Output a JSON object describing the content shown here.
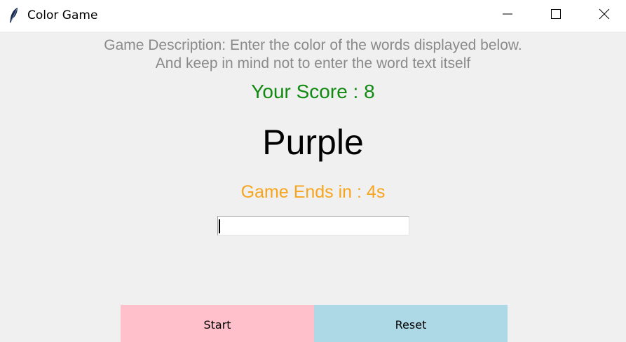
{
  "window": {
    "title": "Color Game"
  },
  "game": {
    "description_line1": "Game Description: Enter the color of the words displayed below.",
    "description_line2": "And keep in mind not to enter the word text itself",
    "score": "Your Score : 8",
    "word": "Purple",
    "timer": "Game Ends in : 4s",
    "input_value": ""
  },
  "buttons": {
    "start_label": "Start",
    "reset_label": "Reset"
  },
  "colors": {
    "score": "#118a11",
    "timer": "#f7a51f",
    "description": "#8a8a8a",
    "start_bg": "#ffc0cb",
    "reset_bg": "#add8e6",
    "background": "#f0f0f0"
  },
  "icons": {
    "app": "feather-icon",
    "minimize": "minimize-icon",
    "maximize": "maximize-icon",
    "close": "close-icon"
  }
}
